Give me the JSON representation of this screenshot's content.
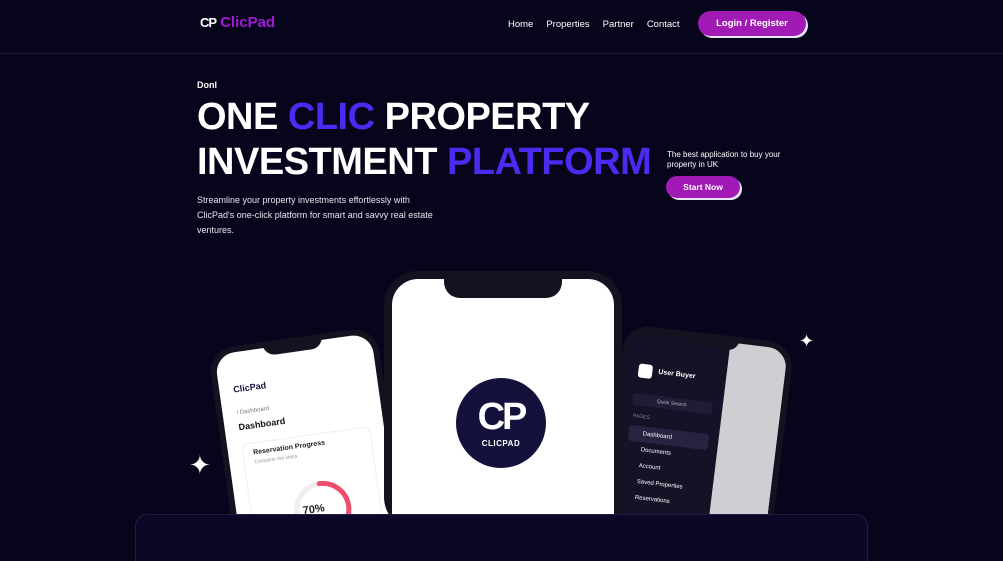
{
  "header": {
    "logo_mark": "CP",
    "logo_text": "ClicPad",
    "nav": [
      "Home",
      "Properties",
      "Partner",
      "Contact"
    ],
    "login_label": "Login / Register"
  },
  "hero": {
    "eyebrow": "Donl",
    "title_line1_a": "ONE ",
    "title_line1_accent": "CLIC",
    "title_line1_b": " PROPERTY",
    "title_line2_a": "INVESTMENT ",
    "title_line2_accent": "PLATFORM",
    "description": "Streamline your property investments effortlessly with ClicPad's one-click platform for smart and savvy real estate ventures.",
    "side_note": "The best application to buy your property in UK",
    "cta_label": "Start Now"
  },
  "phones": {
    "left": {
      "brand": "ClicPad",
      "crumb": "/ Dashboard",
      "title": "Dashboard",
      "card_title": "Reservation Progress",
      "card_sub": "Complete the steps",
      "progress_percent": 70,
      "progress_label": "70%"
    },
    "center": {
      "badge_letters": "CP",
      "badge_name": "CLICPAD"
    },
    "right": {
      "user": "User Buyer",
      "search": "Quick Search",
      "section": "PAGES",
      "menu": [
        "Dashboard",
        "Documents",
        "Account",
        "Saved Properties",
        "Reservations"
      ]
    }
  },
  "colors": {
    "background": "#07051c",
    "accent_blue": "#4b2bf0",
    "button_purple": "#a11ab5",
    "logo_purple": "#a21ad6"
  }
}
